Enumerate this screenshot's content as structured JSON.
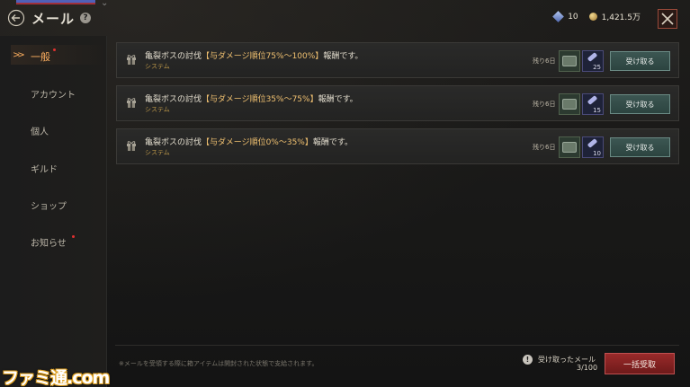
{
  "header": {
    "title": "メール",
    "back_icon": "back-arrow-icon",
    "help_glyph": "?"
  },
  "currency": {
    "gems": "10",
    "gold": "1,421.5万",
    "gem_color": "#8aa0e0",
    "gold_color": "#d0a850"
  },
  "sidebar": {
    "items": [
      {
        "label": "一般",
        "active": true,
        "badge": true
      },
      {
        "label": "アカウント",
        "active": false,
        "badge": false
      },
      {
        "label": "個人",
        "active": false,
        "badge": false
      },
      {
        "label": "ギルド",
        "active": false,
        "badge": false
      },
      {
        "label": "ショップ",
        "active": false,
        "badge": false
      },
      {
        "label": "お知らせ",
        "active": false,
        "badge": true
      }
    ]
  },
  "mails": [
    {
      "title_prefix": "亀裂ボスの討伐",
      "title_highlight": "【与ダメージ順位75%～100%】",
      "title_suffix": "報酬です。",
      "sender": "システム",
      "remaining": "残り6日",
      "item_count": "25",
      "claim_label": "受け取る"
    },
    {
      "title_prefix": "亀裂ボスの討伐",
      "title_highlight": "【与ダメージ順位35%～75%】",
      "title_suffix": "報酬です。",
      "sender": "システム",
      "remaining": "残り6日",
      "item_count": "15",
      "claim_label": "受け取る"
    },
    {
      "title_prefix": "亀裂ボスの討伐",
      "title_highlight": "【与ダメージ順位0%～35%】",
      "title_suffix": "報酬です。",
      "sender": "システム",
      "remaining": "残り6日",
      "item_count": "10",
      "claim_label": "受け取る"
    }
  ],
  "footer": {
    "note": "※メールを受領する際に箱アイテムは開封された状態で支給されます。",
    "received_label": "受け取ったメール",
    "received_count": "3/100",
    "claim_all_label": "一括受取"
  },
  "watermark": "ファミ通.com",
  "colors": {
    "accent_orange": "#ffb060",
    "highlight_gold": "#f0c070",
    "claim_teal": "#3c5652",
    "claim_all_red": "#9a2a2a",
    "badge_red": "#e03030"
  }
}
